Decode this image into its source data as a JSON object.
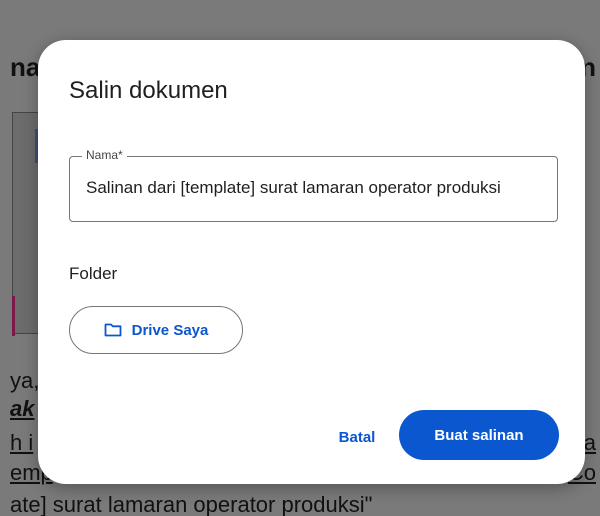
{
  "background_doc": {
    "fragment_top_left": "na",
    "fragment_top_right": "n",
    "fragment_line1": "ya,",
    "fragment_line2": "ak",
    "fragment_line3_left": "h i",
    "fragment_line3_right": "a",
    "fragment_line4_left": "emp",
    "fragment_line4_right": "Co",
    "fragment_line5": "ate] surat lamaran operator produksi\""
  },
  "dialog": {
    "title": "Salin dokumen",
    "name_field": {
      "label": "Nama*",
      "value": "Salinan dari [template] surat lamaran operator produksi"
    },
    "folder": {
      "label": "Folder",
      "button_label": "Drive Saya",
      "icon": "folder-icon"
    },
    "cancel_label": "Batal",
    "primary_label": "Buat salinan"
  },
  "colors": {
    "accent": "#0b57d0",
    "dialog_bg": "#ffffff",
    "scrim": "#7a7a7a"
  }
}
